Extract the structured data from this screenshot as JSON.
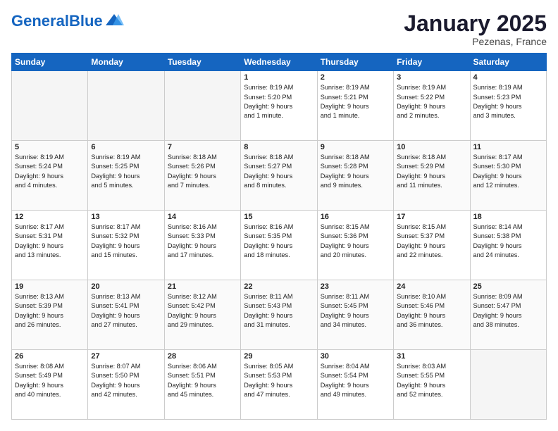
{
  "header": {
    "logo_general": "General",
    "logo_blue": "Blue",
    "month": "January 2025",
    "location": "Pezenas, France"
  },
  "weekdays": [
    "Sunday",
    "Monday",
    "Tuesday",
    "Wednesday",
    "Thursday",
    "Friday",
    "Saturday"
  ],
  "weeks": [
    [
      {
        "day": "",
        "info": ""
      },
      {
        "day": "",
        "info": ""
      },
      {
        "day": "",
        "info": ""
      },
      {
        "day": "1",
        "info": "Sunrise: 8:19 AM\nSunset: 5:20 PM\nDaylight: 9 hours\nand 1 minute."
      },
      {
        "day": "2",
        "info": "Sunrise: 8:19 AM\nSunset: 5:21 PM\nDaylight: 9 hours\nand 1 minute."
      },
      {
        "day": "3",
        "info": "Sunrise: 8:19 AM\nSunset: 5:22 PM\nDaylight: 9 hours\nand 2 minutes."
      },
      {
        "day": "4",
        "info": "Sunrise: 8:19 AM\nSunset: 5:23 PM\nDaylight: 9 hours\nand 3 minutes."
      }
    ],
    [
      {
        "day": "5",
        "info": "Sunrise: 8:19 AM\nSunset: 5:24 PM\nDaylight: 9 hours\nand 4 minutes."
      },
      {
        "day": "6",
        "info": "Sunrise: 8:19 AM\nSunset: 5:25 PM\nDaylight: 9 hours\nand 5 minutes."
      },
      {
        "day": "7",
        "info": "Sunrise: 8:18 AM\nSunset: 5:26 PM\nDaylight: 9 hours\nand 7 minutes."
      },
      {
        "day": "8",
        "info": "Sunrise: 8:18 AM\nSunset: 5:27 PM\nDaylight: 9 hours\nand 8 minutes."
      },
      {
        "day": "9",
        "info": "Sunrise: 8:18 AM\nSunset: 5:28 PM\nDaylight: 9 hours\nand 9 minutes."
      },
      {
        "day": "10",
        "info": "Sunrise: 8:18 AM\nSunset: 5:29 PM\nDaylight: 9 hours\nand 11 minutes."
      },
      {
        "day": "11",
        "info": "Sunrise: 8:17 AM\nSunset: 5:30 PM\nDaylight: 9 hours\nand 12 minutes."
      }
    ],
    [
      {
        "day": "12",
        "info": "Sunrise: 8:17 AM\nSunset: 5:31 PM\nDaylight: 9 hours\nand 13 minutes."
      },
      {
        "day": "13",
        "info": "Sunrise: 8:17 AM\nSunset: 5:32 PM\nDaylight: 9 hours\nand 15 minutes."
      },
      {
        "day": "14",
        "info": "Sunrise: 8:16 AM\nSunset: 5:33 PM\nDaylight: 9 hours\nand 17 minutes."
      },
      {
        "day": "15",
        "info": "Sunrise: 8:16 AM\nSunset: 5:35 PM\nDaylight: 9 hours\nand 18 minutes."
      },
      {
        "day": "16",
        "info": "Sunrise: 8:15 AM\nSunset: 5:36 PM\nDaylight: 9 hours\nand 20 minutes."
      },
      {
        "day": "17",
        "info": "Sunrise: 8:15 AM\nSunset: 5:37 PM\nDaylight: 9 hours\nand 22 minutes."
      },
      {
        "day": "18",
        "info": "Sunrise: 8:14 AM\nSunset: 5:38 PM\nDaylight: 9 hours\nand 24 minutes."
      }
    ],
    [
      {
        "day": "19",
        "info": "Sunrise: 8:13 AM\nSunset: 5:39 PM\nDaylight: 9 hours\nand 26 minutes."
      },
      {
        "day": "20",
        "info": "Sunrise: 8:13 AM\nSunset: 5:41 PM\nDaylight: 9 hours\nand 27 minutes."
      },
      {
        "day": "21",
        "info": "Sunrise: 8:12 AM\nSunset: 5:42 PM\nDaylight: 9 hours\nand 29 minutes."
      },
      {
        "day": "22",
        "info": "Sunrise: 8:11 AM\nSunset: 5:43 PM\nDaylight: 9 hours\nand 31 minutes."
      },
      {
        "day": "23",
        "info": "Sunrise: 8:11 AM\nSunset: 5:45 PM\nDaylight: 9 hours\nand 34 minutes."
      },
      {
        "day": "24",
        "info": "Sunrise: 8:10 AM\nSunset: 5:46 PM\nDaylight: 9 hours\nand 36 minutes."
      },
      {
        "day": "25",
        "info": "Sunrise: 8:09 AM\nSunset: 5:47 PM\nDaylight: 9 hours\nand 38 minutes."
      }
    ],
    [
      {
        "day": "26",
        "info": "Sunrise: 8:08 AM\nSunset: 5:49 PM\nDaylight: 9 hours\nand 40 minutes."
      },
      {
        "day": "27",
        "info": "Sunrise: 8:07 AM\nSunset: 5:50 PM\nDaylight: 9 hours\nand 42 minutes."
      },
      {
        "day": "28",
        "info": "Sunrise: 8:06 AM\nSunset: 5:51 PM\nDaylight: 9 hours\nand 45 minutes."
      },
      {
        "day": "29",
        "info": "Sunrise: 8:05 AM\nSunset: 5:53 PM\nDaylight: 9 hours\nand 47 minutes."
      },
      {
        "day": "30",
        "info": "Sunrise: 8:04 AM\nSunset: 5:54 PM\nDaylight: 9 hours\nand 49 minutes."
      },
      {
        "day": "31",
        "info": "Sunrise: 8:03 AM\nSunset: 5:55 PM\nDaylight: 9 hours\nand 52 minutes."
      },
      {
        "day": "",
        "info": ""
      }
    ]
  ]
}
